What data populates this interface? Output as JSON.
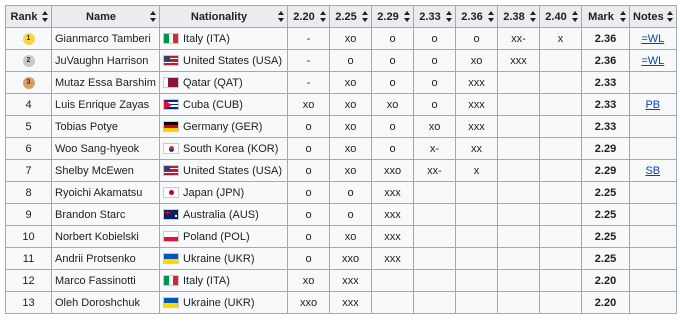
{
  "headers": [
    "Rank",
    "Name",
    "Nationality",
    "2.20",
    "2.25",
    "2.29",
    "2.33",
    "2.36",
    "2.38",
    "2.40",
    "Mark",
    "Notes"
  ],
  "rows": [
    {
      "rank": "1",
      "medal": "gold",
      "medal_color": "#f7d44a",
      "name": "Gianmarco Tamberi",
      "flag": "italy-flag",
      "country": "Italy (ITA)",
      "h": [
        "-",
        "xo",
        "o",
        "o",
        "o",
        "xx-",
        "x"
      ],
      "mark": "2.36",
      "notes": "=WL"
    },
    {
      "rank": "2",
      "medal": "silver",
      "medal_color": "#c9c9c9",
      "name": "JuVaughn Harrison",
      "flag": "usa-flag",
      "country": "United States (USA)",
      "h": [
        "-",
        "o",
        "o",
        "o",
        "xo",
        "xxx",
        ""
      ],
      "mark": "2.36",
      "notes": "=WL"
    },
    {
      "rank": "3",
      "medal": "bronze",
      "medal_color": "#d9a066",
      "name": "Mutaz Essa Barshim",
      "flag": "qatar-flag",
      "country": "Qatar (QAT)",
      "h": [
        "-",
        "xo",
        "o",
        "o",
        "xxx",
        "",
        ""
      ],
      "mark": "2.33",
      "notes": ""
    },
    {
      "rank": "4",
      "medal": "",
      "name": "Luis Enrique Zayas",
      "flag": "cuba-flag",
      "country": "Cuba (CUB)",
      "h": [
        "xo",
        "xo",
        "xo",
        "o",
        "xxx",
        "",
        ""
      ],
      "mark": "2.33",
      "notes": "PB"
    },
    {
      "rank": "5",
      "medal": "",
      "name": "Tobias Potye",
      "flag": "germany-flag",
      "country": "Germany (GER)",
      "h": [
        "o",
        "xo",
        "o",
        "xo",
        "xxx",
        "",
        ""
      ],
      "mark": "2.33",
      "notes": ""
    },
    {
      "rank": "6",
      "medal": "",
      "name": "Woo Sang-hyeok",
      "flag": "korea-flag",
      "country": "South Korea (KOR)",
      "h": [
        "o",
        "xo",
        "o",
        "x-",
        "xx",
        "",
        ""
      ],
      "mark": "2.29",
      "notes": ""
    },
    {
      "rank": "7",
      "medal": "",
      "name": "Shelby McEwen",
      "flag": "usa-flag",
      "country": "United States (USA)",
      "h": [
        "o",
        "xo",
        "xxo",
        "xx-",
        "x",
        "",
        ""
      ],
      "mark": "2.29",
      "notes": "SB"
    },
    {
      "rank": "8",
      "medal": "",
      "name": "Ryoichi Akamatsu",
      "flag": "japan-flag",
      "country": "Japan (JPN)",
      "h": [
        "o",
        "o",
        "xxx",
        "",
        "",
        "",
        ""
      ],
      "mark": "2.25",
      "notes": ""
    },
    {
      "rank": "9",
      "medal": "",
      "name": "Brandon Starc",
      "flag": "australia-flag",
      "country": "Australia (AUS)",
      "h": [
        "o",
        "o",
        "xxx",
        "",
        "",
        "",
        ""
      ],
      "mark": "2.25",
      "notes": ""
    },
    {
      "rank": "10",
      "medal": "",
      "name": "Norbert Kobielski",
      "flag": "poland-flag",
      "country": "Poland (POL)",
      "h": [
        "o",
        "xo",
        "xxx",
        "",
        "",
        "",
        ""
      ],
      "mark": "2.25",
      "notes": ""
    },
    {
      "rank": "11",
      "medal": "",
      "name": "Andrii Protsenko",
      "flag": "ukraine-flag",
      "country": "Ukraine (UKR)",
      "h": [
        "o",
        "xxo",
        "xxx",
        "",
        "",
        "",
        ""
      ],
      "mark": "2.25",
      "notes": ""
    },
    {
      "rank": "12",
      "medal": "",
      "name": "Marco Fassinotti",
      "flag": "italy-flag",
      "country": "Italy (ITA)",
      "h": [
        "xo",
        "xxx",
        "",
        "",
        "",
        "",
        ""
      ],
      "mark": "2.20",
      "notes": ""
    },
    {
      "rank": "13",
      "medal": "",
      "name": "Oleh Doroshchuk",
      "flag": "ukraine-flag",
      "country": "Ukraine (UKR)",
      "h": [
        "xxo",
        "xxx",
        "",
        "",
        "",
        "",
        ""
      ],
      "mark": "2.20",
      "notes": ""
    }
  ]
}
